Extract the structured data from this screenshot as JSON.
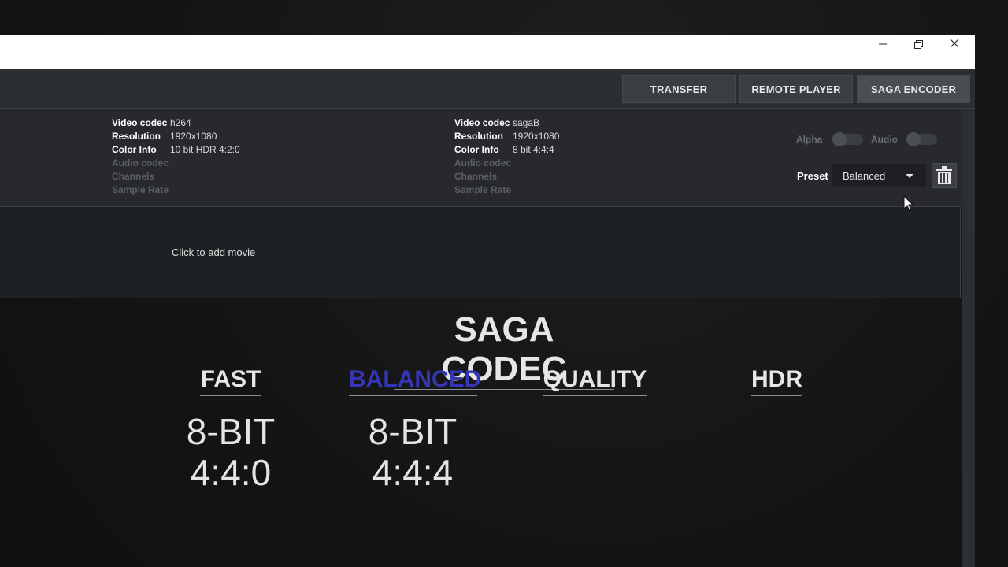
{
  "window": {
    "controls": [
      "minimize-icon",
      "restore-icon",
      "close-icon"
    ]
  },
  "toolbar": {
    "buttons": [
      {
        "label": "TRANSFER"
      },
      {
        "label": "REMOTE PLAYER"
      },
      {
        "label": "SAGA ENCODER",
        "active": true
      }
    ]
  },
  "source": {
    "video_codec_label": "Video codec",
    "video_codec": "h264",
    "resolution_label": "Resolution",
    "resolution": "1920x1080",
    "color_info_label": "Color Info",
    "color_info": "10 bit HDR 4:2:0",
    "audio_codec_label": "Audio codec",
    "channels_label": "Channels",
    "sample_rate_label": "Sample Rate"
  },
  "output": {
    "video_codec_label": "Video codec",
    "video_codec": "sagaB",
    "resolution_label": "Resolution",
    "resolution": "1920x1080",
    "color_info_label": "Color Info",
    "color_info": "8 bit 4:4:4",
    "audio_codec_label": "Audio codec",
    "channels_label": "Channels",
    "sample_rate_label": "Sample Rate"
  },
  "options": {
    "alpha_label": "Alpha",
    "alpha_on": false,
    "audio_label": "Audio",
    "audio_on": false,
    "preset_label": "Preset",
    "preset_value": "Balanced"
  },
  "drop_zone": {
    "text": "Click to add movie"
  },
  "overlay": {
    "title": "SAGA CODEC",
    "modes": [
      {
        "label": "FAST",
        "bit_depth": "8-BIT",
        "sampling": "4:4:0"
      },
      {
        "label": "BALANCED",
        "bit_depth": "8-BIT",
        "sampling": "4:4:4",
        "selected": true,
        "color": "#3535b8"
      },
      {
        "label": "QUALITY"
      },
      {
        "label": "HDR"
      }
    ]
  }
}
